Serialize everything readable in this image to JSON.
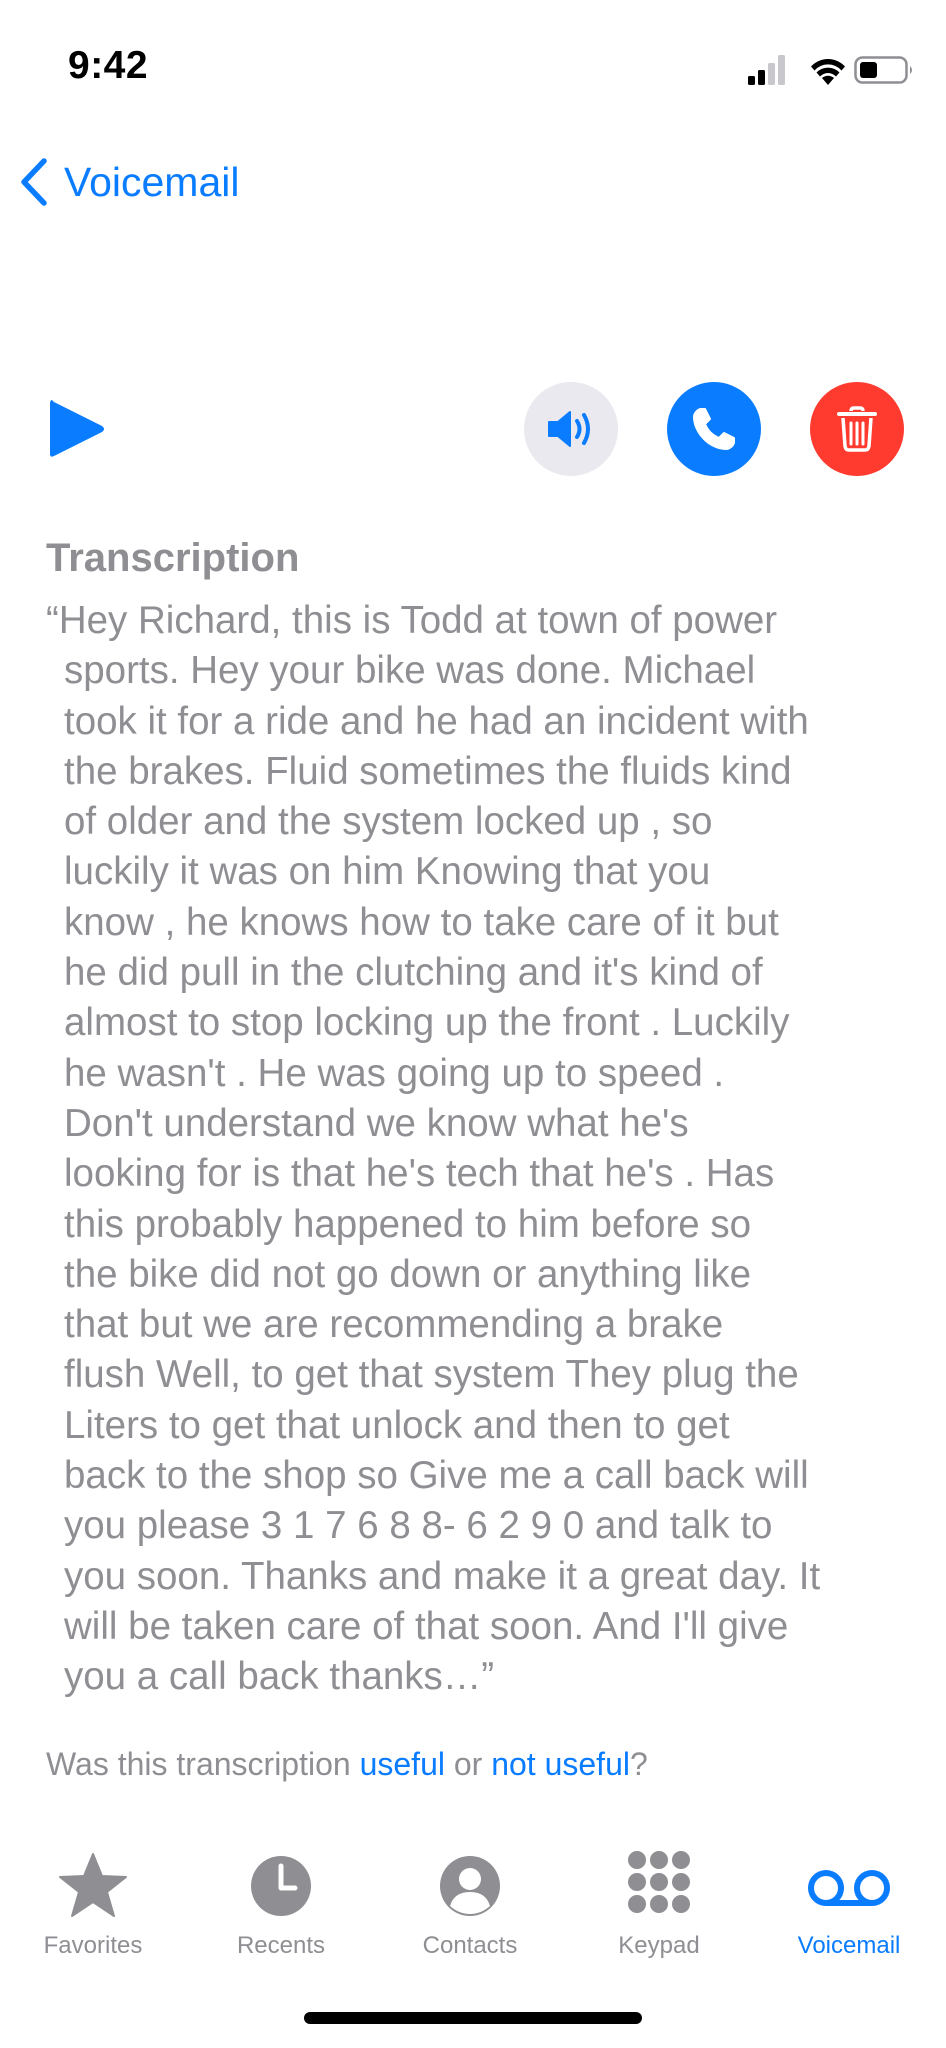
{
  "status_bar": {
    "time": "9:42"
  },
  "nav": {
    "back_label": "Voicemail"
  },
  "transcription": {
    "heading": "Transcription",
    "text": "“Hey Richard, this is Todd at town of power\nsports. Hey your bike was done. Michael\ntook it for a ride and he had an incident with\nthe brakes. Fluid sometimes the fluids kind\nof older and the system locked up , so\nluckily it was on him Knowing that you\nknow , he knows how to take care of it but\nhe did pull in the clutching and it's kind of\nalmost to stop locking up the front . Luckily\nhe wasn't . He was going up to speed .\nDon't understand we know what he's\nlooking for is that he's tech that he's . Has\nthis probably happened to him before so\nthe bike did not go down or anything like\nthat but we are recommending a brake\nflush Well, to get that system They plug the\nLiters to get that unlock and then to get\nback to the shop so Give me a call back will\nyou please 3 1 7 6 8 8- 6 2 9 0 and talk to\nyou soon. Thanks and make it a great day. It\nwill be taken care of that soon. And I'll give\nyou a call back thanks…”"
  },
  "feedback": {
    "prefix": "Was this transcription ",
    "useful": "useful",
    "or": " or ",
    "not_useful": "not useful",
    "suffix": "?"
  },
  "tabs": [
    {
      "label": "Favorites",
      "icon": "star-icon"
    },
    {
      "label": "Recents",
      "icon": "clock-icon"
    },
    {
      "label": "Contacts",
      "icon": "person-circle-icon"
    },
    {
      "label": "Keypad",
      "icon": "keypad-icon"
    },
    {
      "label": "Voicemail",
      "icon": "voicemail-icon",
      "active": true
    }
  ],
  "colors": {
    "accent": "#0a7cff",
    "delete": "#ff3b30",
    "secondary_text": "#8e8e93",
    "speaker_bg": "#e9e9ef"
  }
}
